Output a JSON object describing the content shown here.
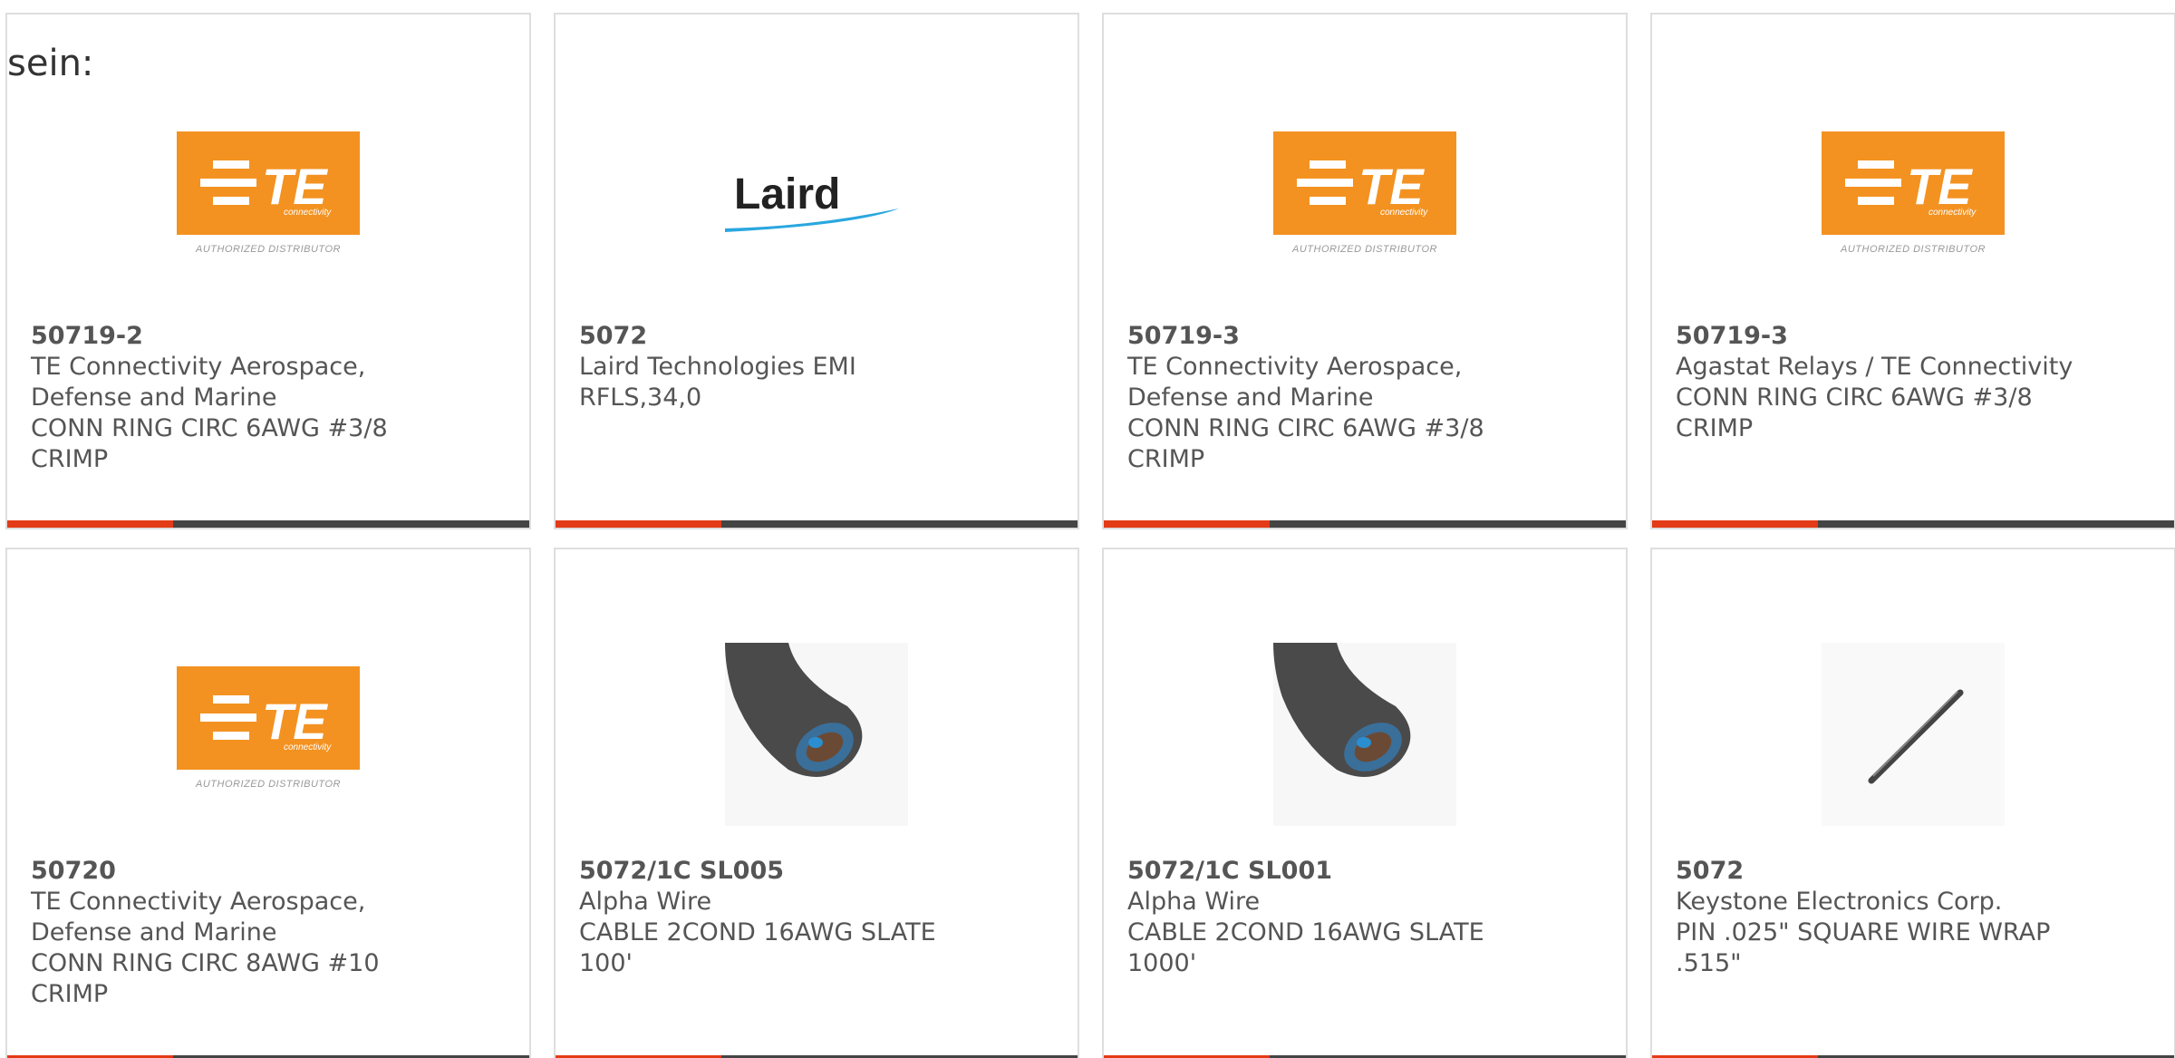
{
  "intro_text": "sein:",
  "colors": {
    "accent_bar": "#e33b17",
    "dark_bar": "#444444",
    "te_orange": "#f39221",
    "laird_swoosh": "#2aa7df"
  },
  "cards": [
    {
      "part": "50719-2",
      "manufacturer_line1": "TE Connectivity Aerospace,",
      "manufacturer_line2": "Defense and Marine",
      "desc_line1": "CONN RING CIRC 6AWG #3/8",
      "desc_line2": "CRIMP",
      "image": "te-logo",
      "te_caption": "AUTHORIZED DISTRIBUTOR",
      "te_sub": "connectivity"
    },
    {
      "part": "5072",
      "manufacturer_line1": "Laird Technologies EMI",
      "manufacturer_line2": "",
      "desc_line1": "RFLS,34,0",
      "desc_line2": "",
      "image": "laird-logo",
      "laird_text": "Laird"
    },
    {
      "part": "50719-3",
      "manufacturer_line1": "TE Connectivity Aerospace,",
      "manufacturer_line2": "Defense and Marine",
      "desc_line1": "CONN RING CIRC 6AWG #3/8",
      "desc_line2": "CRIMP",
      "image": "te-logo",
      "te_caption": "AUTHORIZED DISTRIBUTOR",
      "te_sub": "connectivity"
    },
    {
      "part": "50719-3",
      "manufacturer_line1": "Agastat Relays / TE Connectivity",
      "manufacturer_line2": "",
      "desc_line1": "CONN RING CIRC 6AWG #3/8",
      "desc_line2": "CRIMP",
      "image": "te-logo",
      "te_caption": "AUTHORIZED DISTRIBUTOR",
      "te_sub": "connectivity"
    },
    {
      "part": "50720",
      "manufacturer_line1": "TE Connectivity Aerospace,",
      "manufacturer_line2": "Defense and Marine",
      "desc_line1": "CONN RING CIRC 8AWG #10",
      "desc_line2": "CRIMP",
      "image": "te-logo",
      "te_caption": "AUTHORIZED DISTRIBUTOR",
      "te_sub": "connectivity"
    },
    {
      "part": "5072/1C SL005",
      "manufacturer_line1": "Alpha Wire",
      "manufacturer_line2": "",
      "desc_line1": "CABLE 2COND 16AWG SLATE",
      "desc_line2": "100'",
      "image": "cable-photo"
    },
    {
      "part": "5072/1C SL001",
      "manufacturer_line1": "Alpha Wire",
      "manufacturer_line2": "",
      "desc_line1": "CABLE 2COND 16AWG SLATE",
      "desc_line2": "1000'",
      "image": "cable-photo"
    },
    {
      "part": "5072",
      "manufacturer_line1": "Keystone Electronics Corp.",
      "manufacturer_line2": "",
      "desc_line1": "PIN .025\" SQUARE WIRE WRAP",
      "desc_line2": ".515\"",
      "image": "pin-photo"
    }
  ]
}
